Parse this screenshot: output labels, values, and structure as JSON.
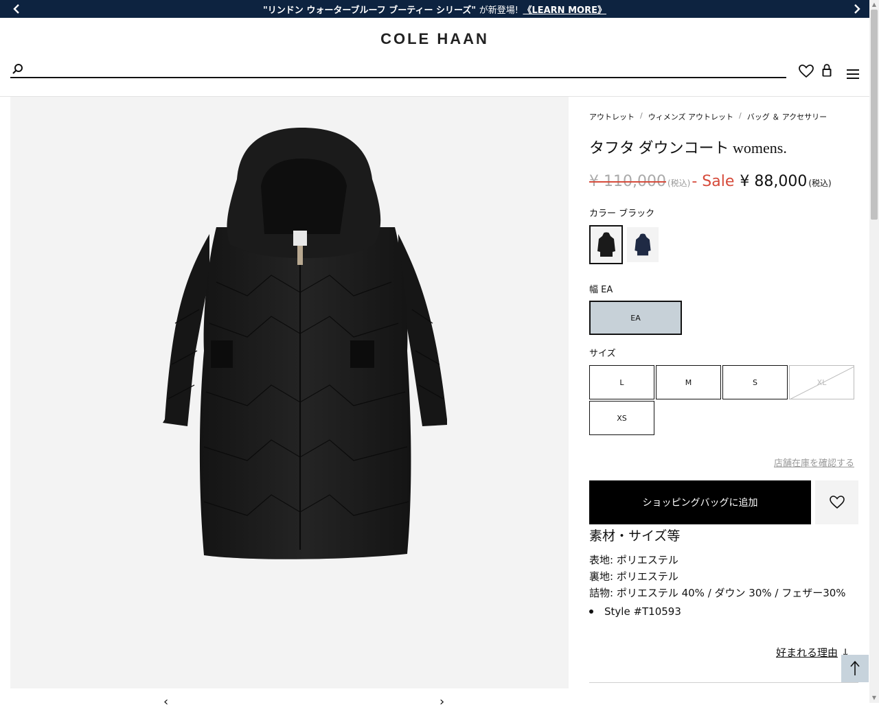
{
  "promo": {
    "headline": "\"リンドン ウォーターブルーフ ブーティー シリーズ\"",
    "suffix": "が新登場!",
    "link": "《LEARN MORE》",
    "prev_icon": "chevron-left-icon",
    "next_icon": "chevron-right-icon",
    "bg_color": "#0d2340"
  },
  "header": {
    "logo": "COLE HAAN",
    "search_placeholder": "",
    "icons": [
      "search-icon",
      "heart-icon",
      "bag-icon",
      "menu-icon"
    ]
  },
  "breadcrumb": [
    "アウトレット",
    "ウィメンズ アウトレット",
    "バッグ ＆ アクセサリー"
  ],
  "breadcrumb_sep": "/",
  "product": {
    "title": "タフタ ダウンコート womens.",
    "price_original": "¥ 110,000",
    "tax_label": "(税込)",
    "sale_label": "- Sale",
    "price_sale": "¥ 88,000",
    "sale_color": "#d64a3a"
  },
  "color": {
    "label": "カラー ブラック",
    "swatches": [
      {
        "name": "black",
        "hex": "#1a1a1a",
        "selected": true
      },
      {
        "name": "navy",
        "hex": "#1f2a44",
        "selected": false
      }
    ]
  },
  "width": {
    "label": "幅 EA",
    "option": "EA"
  },
  "size": {
    "label": "サイズ",
    "options": [
      {
        "label": "L",
        "available": true
      },
      {
        "label": "M",
        "available": true
      },
      {
        "label": "S",
        "available": true
      },
      {
        "label": "XL",
        "available": false
      },
      {
        "label": "XS",
        "available": true
      }
    ]
  },
  "stock_link": "店舗在庫を確認する",
  "add_to_bag": "ショッピングバッグに追加",
  "details": {
    "title": "素材・サイズ等",
    "lines": [
      "表地: ポリエステル",
      "裏地: ポリエステル",
      "詰物: ポリエステル 40% / ダウン 30% / フェザー30%"
    ],
    "style": "Style #T10593"
  },
  "why_link": "好まれる理由",
  "why_arrow": "↓"
}
